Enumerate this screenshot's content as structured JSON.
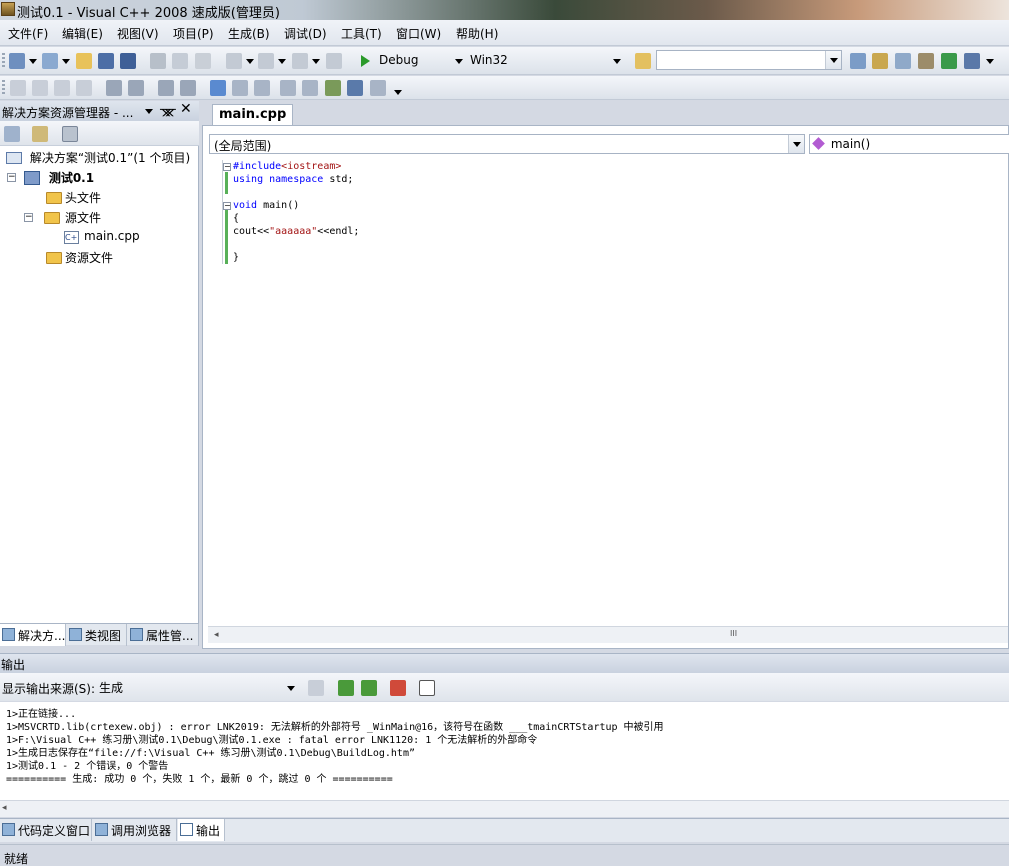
{
  "window": {
    "title": "测试0.1 - Visual C++ 2008 速成版(管理员)"
  },
  "menu": [
    "文件(F)",
    "编辑(E)",
    "视图(V)",
    "项目(P)",
    "生成(B)",
    "调试(D)",
    "工具(T)",
    "窗口(W)",
    "帮助(H)"
  ],
  "toolbar": {
    "config": "Debug",
    "platform": "Win32",
    "find_value": ""
  },
  "solution_explorer": {
    "title": "解决方案资源管理器 - ...",
    "solution": "解决方案“测试0.1”(1 个项目)",
    "project": "测试0.1",
    "header_files": "头文件",
    "source_files": "源文件",
    "main_cpp": "main.cpp",
    "resource_files": "资源文件",
    "tabs": [
      "解决方...",
      "类视图",
      "属性管..."
    ]
  },
  "editor": {
    "tab": "main.cpp",
    "scope": "(全局范围)",
    "function": "main()",
    "code": {
      "l1_directive": "#include",
      "l1_header": "<iostream>",
      "l2_kw": "using namespace",
      "l2_rest": " std;",
      "l4_kw": "void",
      "l4_rest": " main()",
      "l5": "{",
      "l6_a": "cout<<",
      "l6_str": "\"aaaaaa\"",
      "l6_b": "<<endl;",
      "l8": "}"
    },
    "hscroll_thumb": "III"
  },
  "output": {
    "title": "输出",
    "source_label": "显示输出来源(S):",
    "source_value": "生成",
    "lines": [
      "1>正在链接...",
      "1>MSVCRTD.lib(crtexew.obj) : error LNK2019: 无法解析的外部符号 _WinMain@16，该符号在函数 ___tmainCRTStartup 中被引用",
      "1>F:\\Visual C++ 练习册\\测试0.1\\Debug\\测试0.1.exe : fatal error LNK1120: 1 个无法解析的外部命令",
      "1>生成日志保存在“file://f:\\Visual C++ 练习册\\测试0.1\\Debug\\BuildLog.htm”",
      "1>测试0.1 - 2 个错误，0 个警告",
      "========== 生成: 成功 0 个，失败 1 个，最新 0 个，跳过 0 个 =========="
    ]
  },
  "bottom_tabs": [
    "代码定义窗口",
    "调用浏览器",
    "输出"
  ],
  "status": "就绪"
}
